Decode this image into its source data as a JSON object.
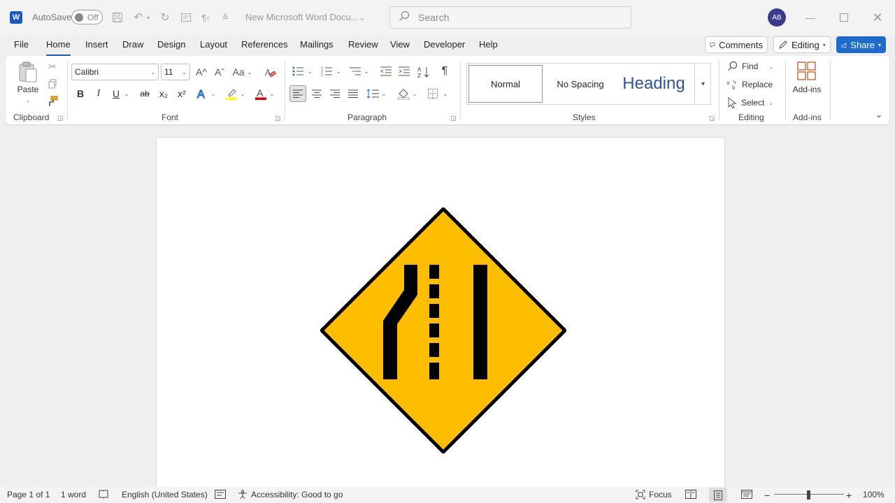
{
  "titlebar": {
    "app_icon": "word-logo",
    "app_letter": "W",
    "autosave_label": "AutoSave",
    "autosave_state": "Off",
    "doc_title": "New Microsoft Word Docu...",
    "search_placeholder": "Search",
    "avatar_initials": "AB"
  },
  "tabs": [
    "File",
    "Home",
    "Insert",
    "Draw",
    "Design",
    "Layout",
    "References",
    "Mailings",
    "Review",
    "View",
    "Developer",
    "Help"
  ],
  "active_tab": "Home",
  "top_buttons": {
    "comments": "Comments",
    "editing": "Editing",
    "share": "Share"
  },
  "ribbon": {
    "clipboard": {
      "label": "Clipboard",
      "paste": "Paste"
    },
    "font": {
      "label": "Font",
      "font_name": "Calibri",
      "font_size": "11",
      "bold": "B",
      "italic": "I",
      "underline": "U",
      "strike": "ab",
      "sub": "x₂",
      "sup": "x²",
      "grow": "A^",
      "shrink": "Aˇ",
      "case": "Aa"
    },
    "paragraph": {
      "label": "Paragraph",
      "pilcrow": "¶"
    },
    "styles": {
      "label": "Styles",
      "items": [
        "Normal",
        "No Spacing",
        "Heading"
      ]
    },
    "editing": {
      "label": "Editing",
      "find": "Find",
      "replace": "Replace",
      "select": "Select"
    },
    "addins": {
      "label": "Add-ins",
      "button": "Add-ins"
    }
  },
  "document": {
    "image": "lane-ends-merge-left-warning-sign",
    "sign_fill": "#FDBE00",
    "sign_stroke": "#000000"
  },
  "status": {
    "page": "Page 1 of 1",
    "words": "1 word",
    "language": "English (United States)",
    "accessibility": "Accessibility: Good to go",
    "focus": "Focus",
    "zoom": "100%"
  },
  "colors": {
    "accent": "#185abd",
    "share": "#1f6bcb",
    "highlight": "#ffff00",
    "font_color": "#e00000"
  }
}
